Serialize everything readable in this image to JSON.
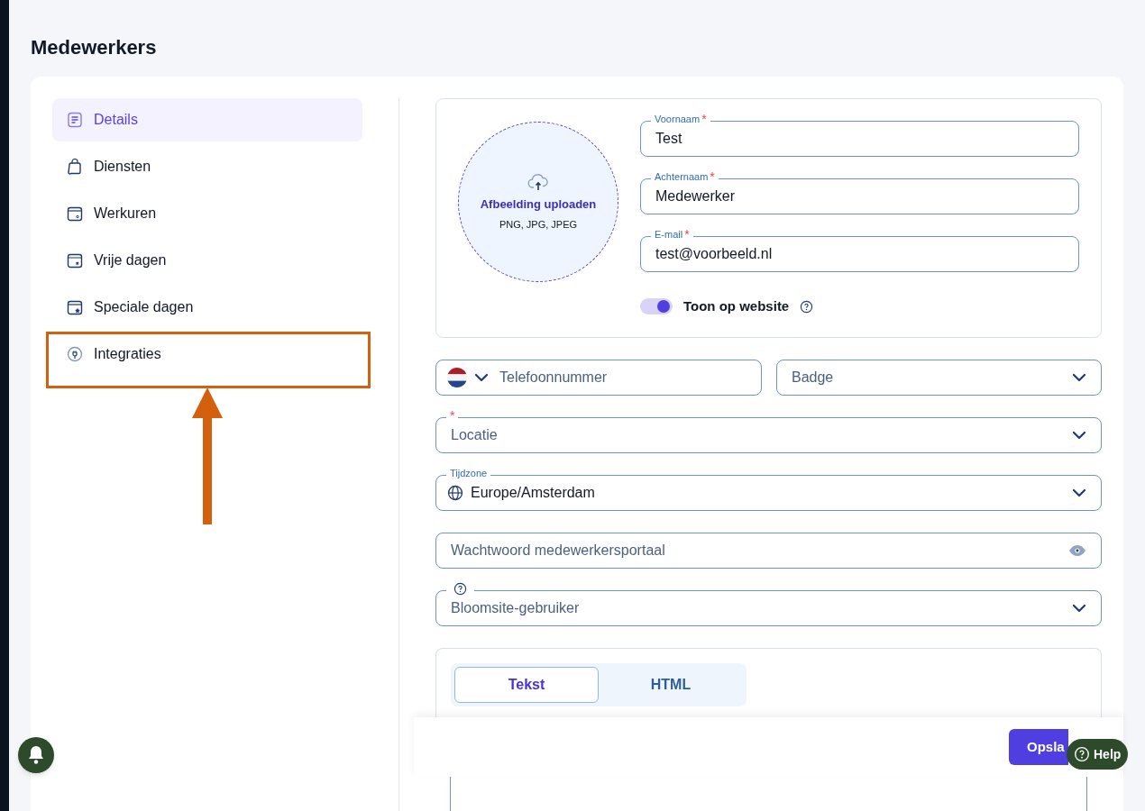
{
  "page_title": "Medewerkers",
  "sidebar": {
    "items": [
      {
        "label": "Details",
        "selected": true
      },
      {
        "label": "Diensten",
        "selected": false
      },
      {
        "label": "Werkuren",
        "selected": false
      },
      {
        "label": "Vrije dagen",
        "selected": false
      },
      {
        "label": "Speciale dagen",
        "selected": false
      },
      {
        "label": "Integraties",
        "selected": false
      }
    ]
  },
  "upload": {
    "title": "Afbeelding uploaden",
    "formats": "PNG, JPG, JPEG"
  },
  "name_fields": [
    {
      "label": "Voornaam",
      "required_mark": "*",
      "value": "Test"
    },
    {
      "label": "Achternaam",
      "required_mark": "*",
      "value": "Medewerker"
    },
    {
      "label": "E-mail",
      "required_mark": "*",
      "value": "test@voorbeeld.nl"
    }
  ],
  "toggle": {
    "label": "Toon op website",
    "on": true
  },
  "phone": {
    "placeholder": "Telefoonnummer"
  },
  "badge": {
    "placeholder": "Badge"
  },
  "fields": [
    {
      "kind": "select",
      "required_mark": "*",
      "placeholder": "Locatie"
    },
    {
      "kind": "timezone",
      "label": "Tijdzone",
      "value": "Europe/Amsterdam"
    },
    {
      "kind": "password",
      "placeholder": "Wachtwoord medewerkersportaal"
    },
    {
      "kind": "select",
      "help": true,
      "placeholder": "Bloomsite-gebruiker"
    }
  ],
  "editor_tabs": [
    {
      "label": "Tekst",
      "selected": true
    },
    {
      "label": "HTML",
      "selected": false
    }
  ],
  "save_button": "Opsla",
  "help_button": "Help"
}
